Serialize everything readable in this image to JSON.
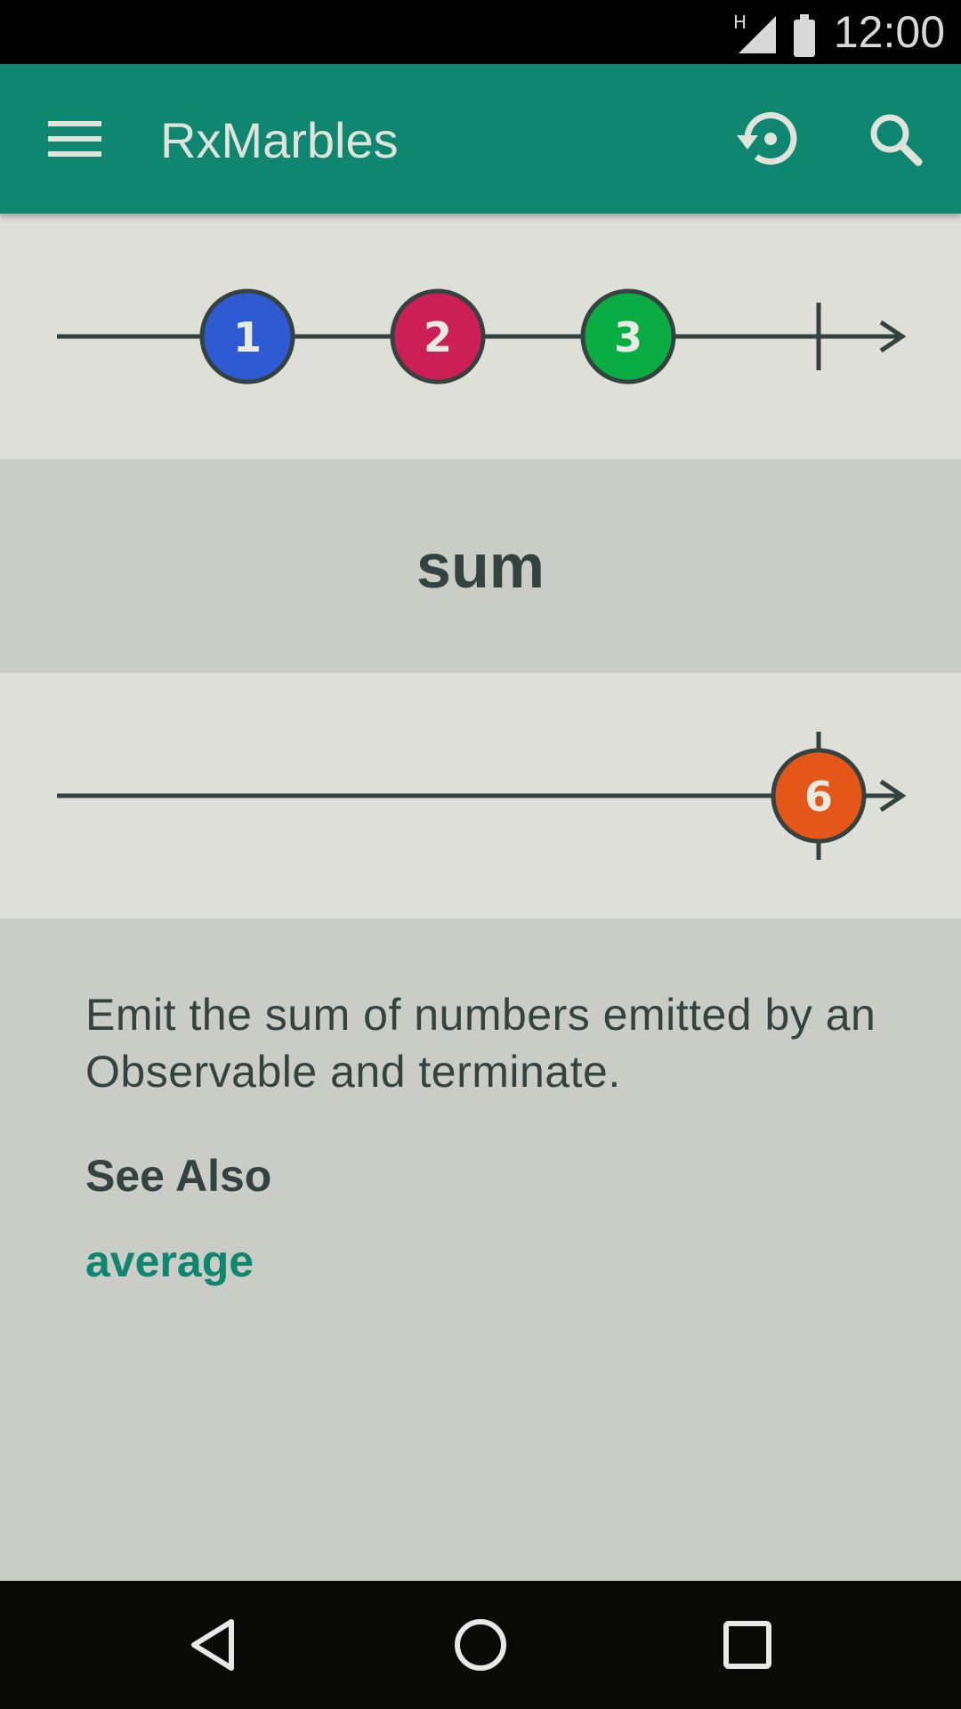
{
  "status_bar": {
    "time": "12:00",
    "network_label": "H",
    "icons": [
      "signal-icon",
      "battery-icon"
    ]
  },
  "app_bar": {
    "title": "RxMarbles",
    "icons": [
      "menu-icon",
      "history-icon",
      "search-icon"
    ],
    "background_color": "#0e8670"
  },
  "input_stream": {
    "marbles": [
      {
        "label": "1",
        "color": "#2e5bd4"
      },
      {
        "label": "2",
        "color": "#cc1f57"
      },
      {
        "label": "3",
        "color": "#0aad43"
      }
    ],
    "completed": true
  },
  "operator": {
    "name": "sum"
  },
  "output_stream": {
    "marbles": [
      {
        "label": "6",
        "color": "#e55719"
      }
    ],
    "completed": true
  },
  "description": {
    "text": "Emit the sum of numbers emitted by an Observable and terminate.",
    "see_also_heading": "See Also",
    "see_also_links": [
      "average"
    ]
  },
  "nav_bar": {
    "icons": [
      "back-icon",
      "home-icon",
      "recents-icon"
    ]
  },
  "colors": {
    "accent": "#0e8670",
    "stream_background": "#dedfd7",
    "panel_background": "#cacdc6",
    "text": "#354340"
  }
}
